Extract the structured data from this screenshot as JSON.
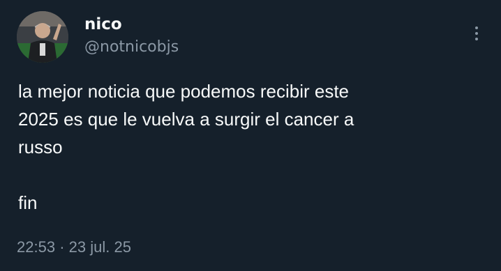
{
  "author": {
    "display_name": "nico",
    "handle": "@notnicobjs",
    "avatar_icon": "profile-photo"
  },
  "tweet": {
    "line_1": "la mejor noticia que podemos recibir este",
    "line_2": "2025 es que le vuelva a surgir el cancer a",
    "line_3": "russo",
    "line_4": "fin"
  },
  "meta": {
    "time": "22:53",
    "separator": "·",
    "date": "23 jul. 25"
  },
  "colors": {
    "background": "#15202b",
    "primary_text": "#f7f9f9",
    "secondary_text": "#8b98a5"
  },
  "icons": {
    "more": "more-options-icon"
  }
}
